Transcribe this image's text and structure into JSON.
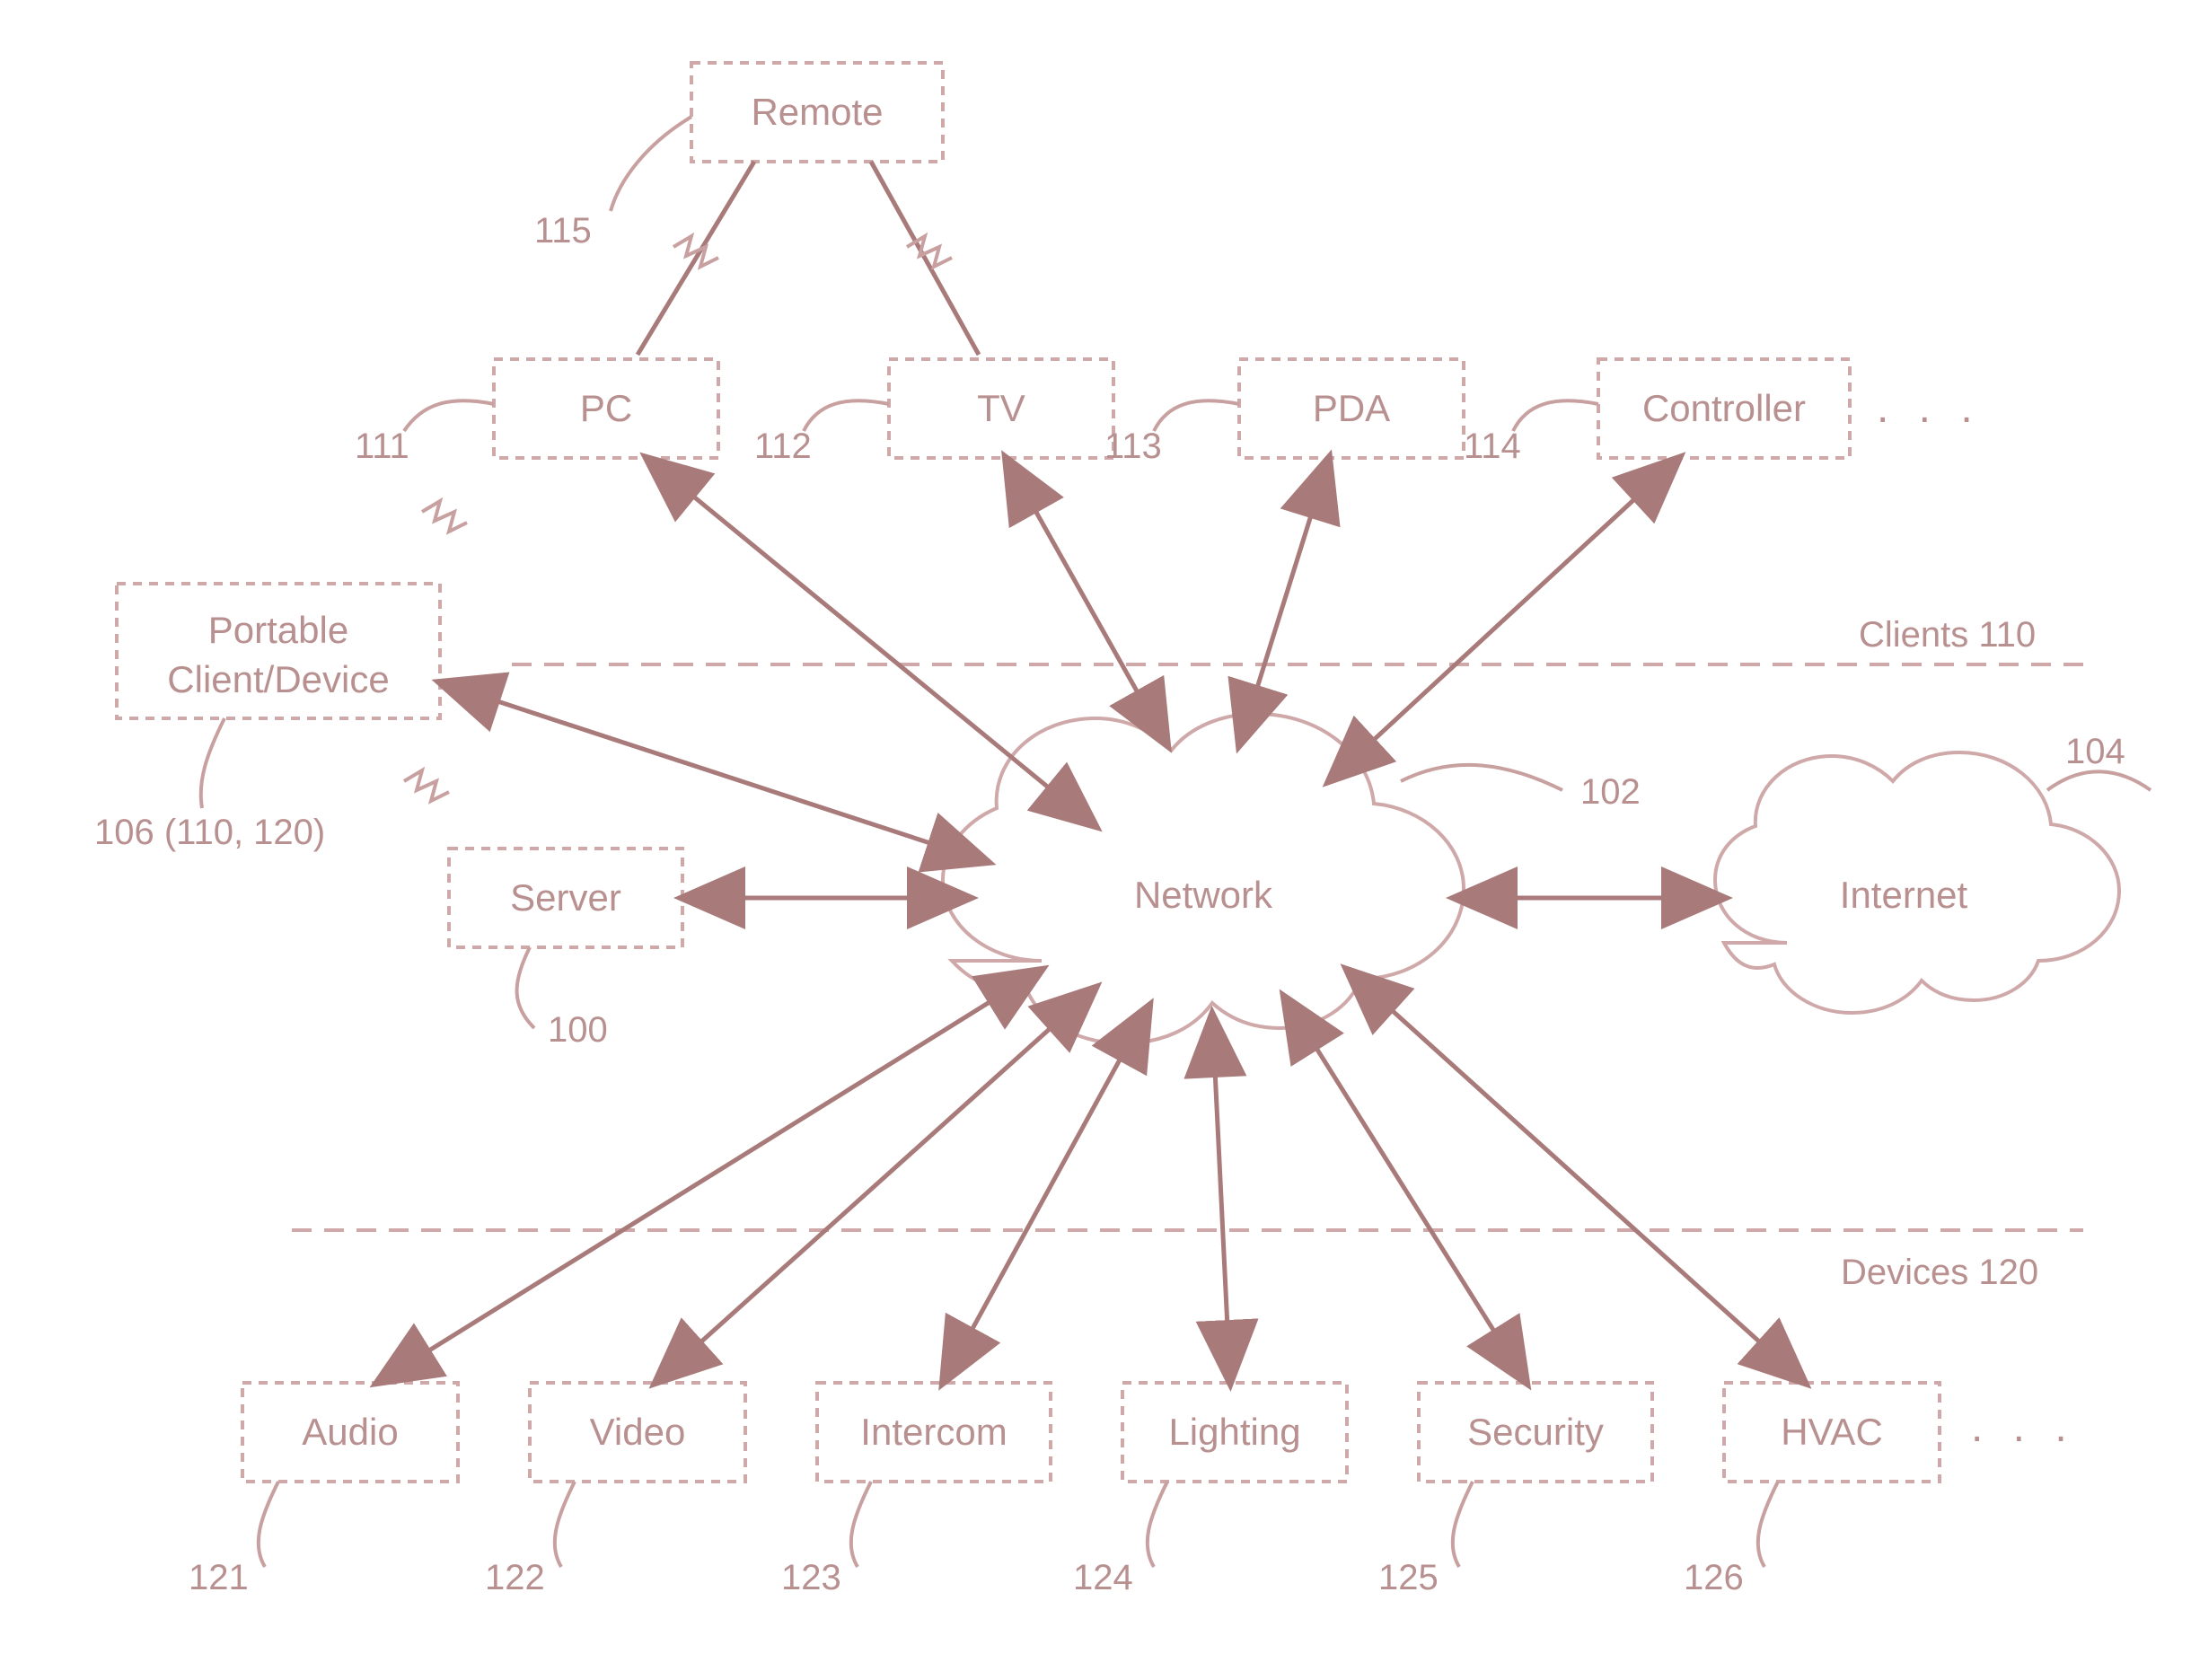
{
  "nodes": {
    "remote": {
      "label": "Remote",
      "ref": "115"
    },
    "pc": {
      "label": "PC",
      "ref": "111"
    },
    "tv": {
      "label": "TV",
      "ref": "112"
    },
    "pda": {
      "label": "PDA",
      "ref": "113"
    },
    "controller": {
      "label": "Controller",
      "ref": "114"
    },
    "portable": {
      "label_l1": "Portable",
      "label_l2": "Client/Device",
      "ref": "106 (110, 120)"
    },
    "server": {
      "label": "Server",
      "ref": "100"
    },
    "network": {
      "label": "Network",
      "ref": "102"
    },
    "internet": {
      "label": "Internet",
      "ref": "104"
    },
    "audio": {
      "label": "Audio",
      "ref": "121"
    },
    "video": {
      "label": "Video",
      "ref": "122"
    },
    "intercom": {
      "label": "Intercom",
      "ref": "123"
    },
    "lighting": {
      "label": "Lighting",
      "ref": "124"
    },
    "security": {
      "label": "Security",
      "ref": "125"
    },
    "hvac": {
      "label": "HVAC",
      "ref": "126"
    }
  },
  "groups": {
    "clients": "Clients 110",
    "devices": "Devices 120"
  },
  "ellipsis": ". . ."
}
